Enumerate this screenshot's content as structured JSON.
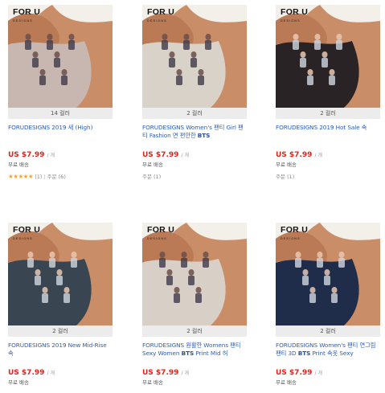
{
  "products": [
    {
      "brand": "FOR U",
      "brand_sub": "DESIGNS",
      "colors": "14 컬러",
      "title": "FORUDESIGNS 2019 새 (High)",
      "title_bold": "",
      "price": "US $7.99",
      "unit": "/ 개",
      "shipping": "무료 배송",
      "rating_stars": "★★★★★",
      "rating_count": "(1)",
      "orders": "주문 (6)",
      "garment": "#c8b7b0"
    },
    {
      "brand": "FOR U",
      "brand_sub": "DESIGNS",
      "colors": "2 컬러",
      "title": "FORUDESIGNS Women's 팬티 Girl 팬티 Fashion 면 편안한 ",
      "title_bold": "BTS",
      "price": "US $7.99",
      "unit": "/ 개",
      "shipping": "무료 배송",
      "rating_stars": "",
      "rating_count": "",
      "orders": "주문 (1)",
      "garment": "#d9d2c8"
    },
    {
      "brand": "FOR U",
      "brand_sub": "DESIGNS",
      "colors": "2 컬러",
      "title": "FORUDESIGNS 2019 Hot Sale 속",
      "title_bold": "",
      "price": "US $7.99",
      "unit": "/ 개",
      "shipping": "무료 배송",
      "rating_stars": "",
      "rating_count": "",
      "orders": "주문 (1)",
      "garment": "#2a2326"
    },
    {
      "brand": "FOR U",
      "brand_sub": "DESIGNS",
      "colors": "2 컬러",
      "title": "FORUDESIGNS 2019 New Mid-Rise 속",
      "title_bold": "",
      "price": "US $7.99",
      "unit": "/ 개",
      "shipping": "무료 배송",
      "rating_stars": "",
      "rating_count": "",
      "orders": "",
      "garment": "#3a4552"
    },
    {
      "brand": "FOR U",
      "brand_sub": "DESIGNS",
      "colors": "2 컬러",
      "title": "FORUDESIGNS 원활한 Womens 팬티 Sexy Women ",
      "title_bold": "BTS",
      "title_tail": " Print Mid 허",
      "price": "US $7.99",
      "unit": "/ 개",
      "shipping": "무료 배송",
      "rating_stars": "",
      "rating_count": "",
      "orders": "",
      "garment": "#d8d0c6"
    },
    {
      "brand": "FOR U",
      "brand_sub": "DESIGNS",
      "colors": "2 컬러",
      "title": "FORUDESIGNS Women's 팬티 연그림 팬티 3D ",
      "title_bold": "BTS",
      "title_tail": " Print 속옷 Sexy",
      "price": "US $7.99",
      "unit": "/ 개",
      "shipping": "무료 배송",
      "rating_stars": "",
      "rating_count": "",
      "orders": "",
      "garment": "#1f2d4a"
    }
  ]
}
